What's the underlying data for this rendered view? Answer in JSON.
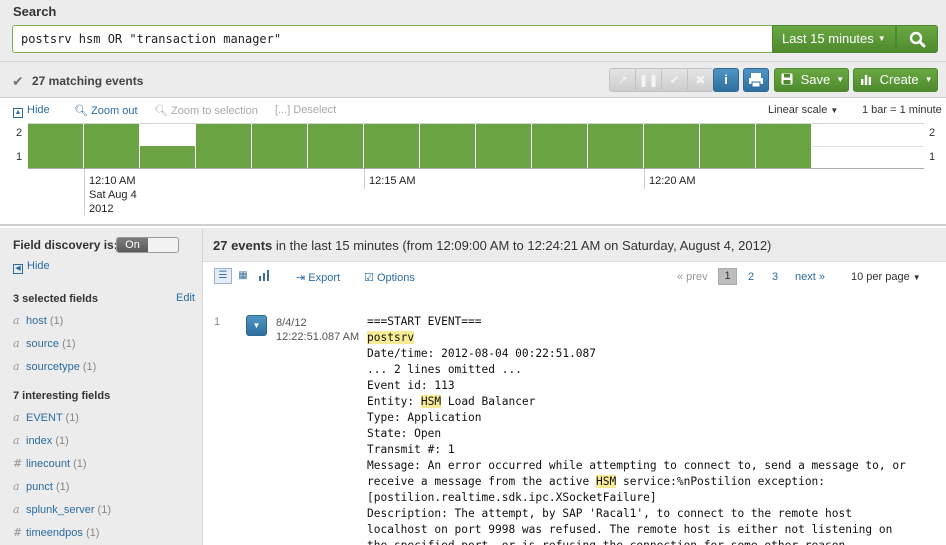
{
  "search": {
    "title": "Search",
    "query": "postsrv hsm OR \"transaction manager\"",
    "time_range": "Last 15 minutes"
  },
  "status": {
    "matching_events": "27 matching events",
    "save_label": "Save",
    "create_label": "Create",
    "info_label": "i"
  },
  "timeline": {
    "tools": {
      "hide": "Hide",
      "zoom_out": "Zoom out",
      "zoom_selection": "Zoom to selection",
      "deselect": "[...] Deselect"
    },
    "scale": "Linear scale",
    "bucket": "1 bar = 1 minute",
    "time_labels": [
      [
        "12:10 AM",
        "Sat Aug 4",
        "2012"
      ],
      [
        "12:15 AM"
      ],
      [
        "12:20 AM"
      ]
    ]
  },
  "chart_data": {
    "type": "bar",
    "categories": [
      "12:09",
      "12:10",
      "12:11",
      "12:12",
      "12:13",
      "12:14",
      "12:15",
      "12:16",
      "12:17",
      "12:18",
      "12:19",
      "12:20",
      "12:21",
      "12:22",
      "12:23",
      "12:24"
    ],
    "values": [
      2,
      2,
      1,
      2,
      2,
      2,
      2,
      2,
      2,
      2,
      2,
      2,
      2,
      2,
      0,
      0
    ],
    "ylim": [
      0,
      2
    ],
    "yticks": [
      "2",
      "1"
    ],
    "grid": true,
    "title": "",
    "xlabel": "",
    "ylabel": ""
  },
  "fields": {
    "discovery_label": "Field discovery is:",
    "toggle_on": "On",
    "hide": "Hide",
    "selected_title": "3 selected fields",
    "edit": "Edit",
    "selected": [
      {
        "type": "a",
        "name": "host",
        "count": "(1)"
      },
      {
        "type": "a",
        "name": "source",
        "count": "(1)"
      },
      {
        "type": "a",
        "name": "sourcetype",
        "count": "(1)"
      }
    ],
    "interesting_title": "7 interesting fields",
    "interesting": [
      {
        "type": "a",
        "name": "EVENT",
        "count": "(1)"
      },
      {
        "type": "a",
        "name": "index",
        "count": "(1)"
      },
      {
        "type": "#",
        "name": "linecount",
        "count": "(1)"
      },
      {
        "type": "a",
        "name": "punct",
        "count": "(1)"
      },
      {
        "type": "a",
        "name": "splunk_server",
        "count": "(1)"
      },
      {
        "type": "#",
        "name": "timeendpos",
        "count": "(1)"
      }
    ]
  },
  "events": {
    "count": "27 events",
    "summary_rest": " in the last 15 minutes (from 12:09:00 AM to 12:24:21 AM on Saturday, August 4, 2012)",
    "export": "Export",
    "options": "Options",
    "prev": "« prev",
    "pages": [
      "1",
      "2",
      "3"
    ],
    "next": "next »",
    "per_page": "10 per page",
    "rows": [
      {
        "num": "1",
        "date": "8/4/12",
        "time": "12:22:51.087 AM",
        "lines": [
          [
            {
              "t": "===START EVENT==="
            }
          ],
          [
            {
              "t": "postsrv",
              "hl": true
            }
          ],
          [
            {
              "t": "Date/time: 2012-08-04 00:22:51.087"
            }
          ],
          [
            {
              "t": "... 2 lines omitted ..."
            }
          ],
          [
            {
              "t": "Event id: 113"
            }
          ],
          [
            {
              "t": "Entity: "
            },
            {
              "t": "HSM",
              "hl": true
            },
            {
              "t": " Load Balancer"
            }
          ],
          [
            {
              "t": "Type: Application"
            }
          ],
          [
            {
              "t": "State: Open"
            }
          ],
          [
            {
              "t": "Transmit #: 1"
            }
          ],
          [
            {
              "t": "Message: An error occurred while attempting to connect to, send a message to, or"
            }
          ],
          [
            {
              "t": "receive a message from the active "
            },
            {
              "t": "HSM",
              "hl": true
            },
            {
              "t": " service:%nPostilion exception:"
            }
          ],
          [
            {
              "t": "[postilion.realtime.sdk.ipc.XSocketFailure]"
            }
          ],
          [
            {
              "t": "Description: The attempt, by SAP 'Racal1', to connect to the remote host"
            }
          ],
          [
            {
              "t": "localhost on port 9998 was refused. The remote host is either not listening on"
            }
          ],
          [
            {
              "t": "the specified port, or is refusing the connection for some other reason."
            }
          ]
        ]
      }
    ]
  },
  "colors": {
    "accent_green": "#5c9a37",
    "bar_green": "#6aa342",
    "link_blue": "#2b6ca2",
    "highlight": "#f7ec95"
  }
}
